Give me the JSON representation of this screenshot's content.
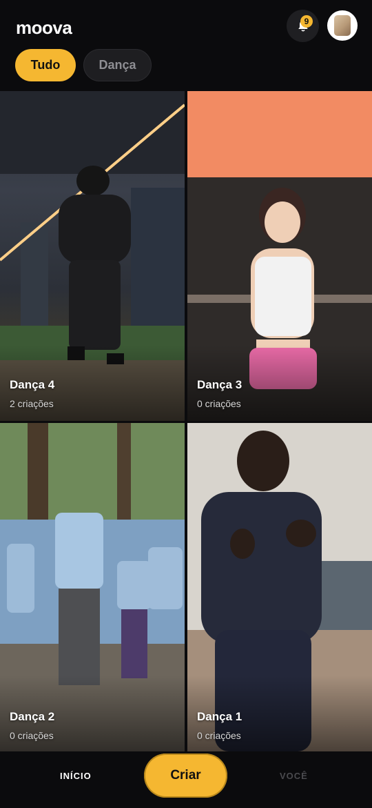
{
  "app": {
    "logo": "moova"
  },
  "header": {
    "notification_count": "9"
  },
  "filters": [
    {
      "label": "Tudo",
      "active": true
    },
    {
      "label": "Dança",
      "active": false
    }
  ],
  "cards": [
    {
      "title": "Dança 4",
      "subtitle": "2 criações"
    },
    {
      "title": "Dança 3",
      "subtitle": "0 criações"
    },
    {
      "title": "Dança 2",
      "subtitle": "0 criações"
    },
    {
      "title": "Dança 1",
      "subtitle": "0 criações"
    }
  ],
  "bottom_nav": {
    "home_label": "INÍCIO",
    "create_label": "Criar",
    "profile_label": "VOCÊ"
  },
  "colors": {
    "accent": "#f5b731",
    "background": "#0b0b0d"
  }
}
